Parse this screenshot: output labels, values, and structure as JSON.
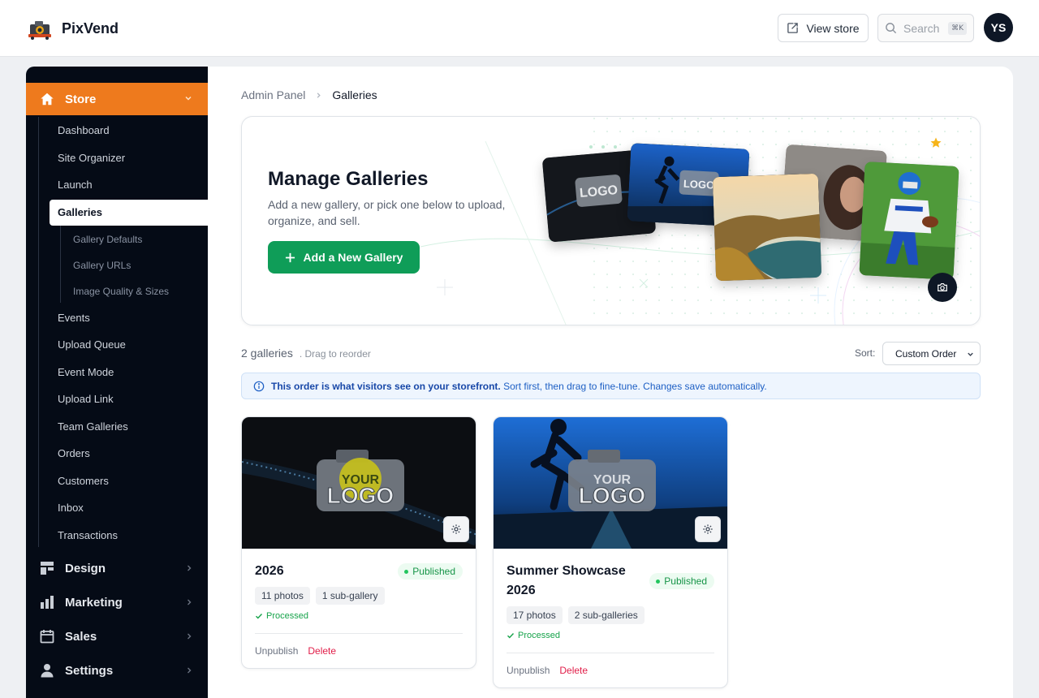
{
  "app": {
    "name": "PixVend"
  },
  "header": {
    "view_store": "View store",
    "search_placeholder": "Search",
    "search_shortcut": "⌘K",
    "avatar_initials": "YS"
  },
  "sidebar": {
    "store_label": "Store",
    "items": [
      {
        "label": "Dashboard"
      },
      {
        "label": "Site Organizer"
      },
      {
        "label": "Launch"
      },
      {
        "label": "Galleries",
        "active": true
      }
    ],
    "gallery_subitems": [
      {
        "label": "Gallery Defaults"
      },
      {
        "label": "Gallery URLs"
      },
      {
        "label": "Image Quality & Sizes"
      }
    ],
    "items_after": [
      {
        "label": "Events"
      },
      {
        "label": "Upload Queue"
      },
      {
        "label": "Event Mode"
      },
      {
        "label": "Upload Link"
      },
      {
        "label": "Team Galleries"
      },
      {
        "label": "Orders"
      },
      {
        "label": "Customers"
      },
      {
        "label": "Inbox"
      },
      {
        "label": "Transactions"
      }
    ],
    "sections": [
      {
        "label": "Design",
        "icon": "layout-icon"
      },
      {
        "label": "Marketing",
        "icon": "bar-chart-icon"
      },
      {
        "label": "Sales",
        "icon": "calendar-icon"
      },
      {
        "label": "Settings",
        "icon": "user-icon"
      }
    ]
  },
  "breadcrumb": {
    "root": "Admin Panel",
    "current": "Galleries"
  },
  "hero": {
    "title": "Manage Galleries",
    "description": "Add a new gallery, or pick one below to upload, organize, and sell.",
    "add_button": "Add a New Gallery",
    "logo_top": "YOUR",
    "logo_bottom": "LOGO"
  },
  "list": {
    "count": "2 galleries",
    "hint": ". Drag to reorder",
    "sort_label": "Sort:",
    "sort_value": "Custom Order",
    "info_bold": "This order is what visitors see on your storefront.",
    "info_rest": " Sort first, then drag to fine-tune. Changes save automatically."
  },
  "galleries": [
    {
      "title": "2026",
      "status": "Published",
      "photos": "11 photos",
      "subgalleries": "1 sub-gallery",
      "processing": "Processed",
      "unpublish": "Unpublish",
      "delete": "Delete"
    },
    {
      "title": "Summer Showcase 2026",
      "status": "Published",
      "photos": "17 photos",
      "subgalleries": "2 sub-galleries",
      "processing": "Processed",
      "unpublish": "Unpublish",
      "delete": "Delete"
    }
  ],
  "colors": {
    "accent": "#ee7a1d",
    "primary": "#0f9d58",
    "sidebar": "#050b16",
    "danger": "#e11d48"
  }
}
